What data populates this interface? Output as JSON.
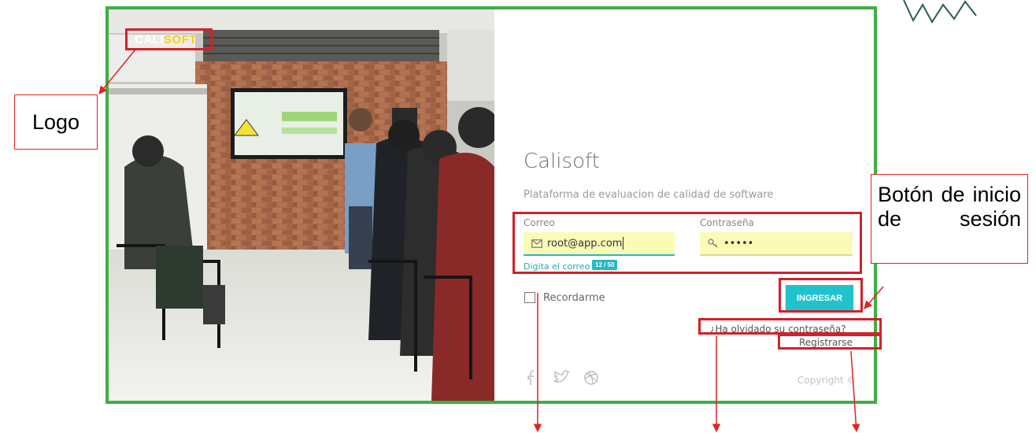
{
  "annotations": {
    "logo": "Logo",
    "login_button": "Botón de inicio de sesión"
  },
  "brand": {
    "part1": "CALI",
    "part2": "SOFT"
  },
  "app": {
    "title": "Calisoft",
    "subtitle": "Plataforma de evaluacion de calidad de software"
  },
  "form": {
    "email_label": "Correo",
    "email_value": "root@app.com",
    "email_hint": "Digita el correo",
    "email_counter": "12 / 50",
    "password_label": "Contraseña",
    "password_value": "•••••",
    "remember_label": "Recordarme",
    "login_label": "INGRESAR",
    "forgot_link": "¿Ha olvidado su contraseña?",
    "register_link": "Registrarse"
  },
  "footer": {
    "social_icons": [
      "facebook-icon",
      "twitter-icon",
      "dribbble-icon"
    ],
    "copyright": "Copyright ©"
  },
  "colors": {
    "frame": "#3fae44",
    "highlight": "#d4202a",
    "accent": "#22c2cc",
    "input_fill": "#fbfbb6",
    "brand_accent": "#f5d016"
  }
}
